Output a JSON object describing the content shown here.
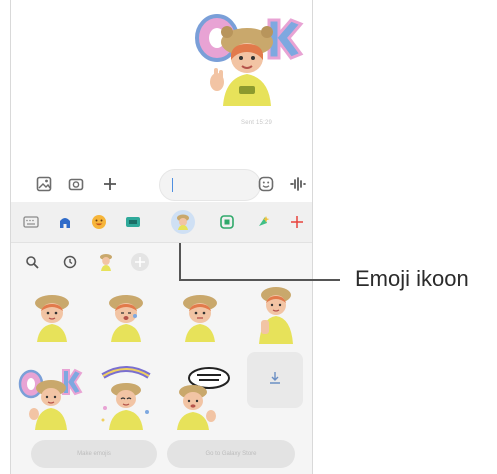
{
  "conversation": {
    "sent_sticker": "bear-hat-avatar-ok-sticker",
    "sent_time": "Sent 15:29"
  },
  "composer": {
    "icons": [
      "gallery-icon",
      "camera-icon",
      "plus-icon",
      "emoji-icon",
      "voice-icon"
    ],
    "input_value": ""
  },
  "sticker_panel": {
    "tabs": [
      "keyboard-icon",
      "home-icon",
      "emoji-icon",
      "sticker-pack-icon",
      "ar-emoji-icon",
      "gif-icon",
      "sparkle-sticker-icon",
      "add-icon"
    ],
    "selected_tab": "ar-emoji-icon",
    "subtabs": [
      "search-icon",
      "recent-icon",
      "avatar-icon",
      "add-icon"
    ],
    "stickers": [
      "avatar-sticker-1",
      "avatar-sticker-2",
      "avatar-sticker-3",
      "avatar-sticker-4",
      "avatar-sticker-ok",
      "avatar-sticker-thanks",
      "avatar-sticker-speech"
    ],
    "download_tile": "download-icon",
    "bottom_buttons": [
      "Make emojis",
      "Go to Galaxy Store"
    ]
  },
  "callout": {
    "label": "Emoji ikoon"
  },
  "colors": {
    "accent_red": "#e8423c",
    "selected_tab_bg": "#cfe0f4",
    "hat": "#c9a86c",
    "shirt": "#e7e25a",
    "skin": "#f2c4a4",
    "hair": "#e27a4b"
  }
}
